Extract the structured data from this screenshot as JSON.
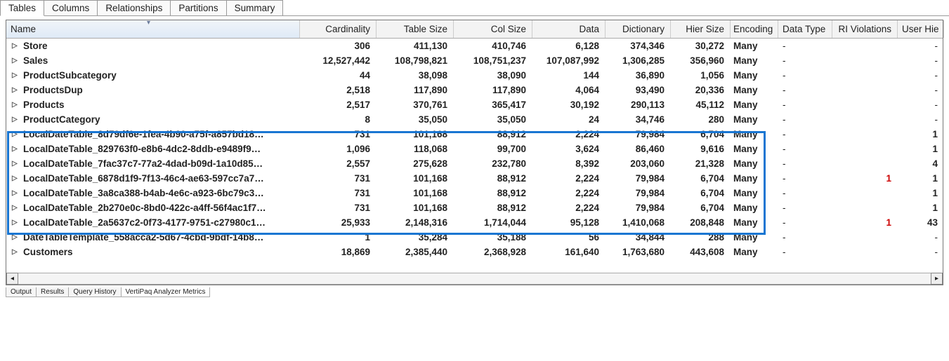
{
  "top_tabs": [
    "Tables",
    "Columns",
    "Relationships",
    "Partitions",
    "Summary"
  ],
  "active_top_tab": 0,
  "headers": {
    "name": "Name",
    "cardinality": "Cardinality",
    "table_size": "Table Size",
    "col_size": "Col Size",
    "data": "Data",
    "dictionary": "Dictionary",
    "hier_size": "Hier Size",
    "encoding": "Encoding",
    "data_type": "Data Type",
    "ri_violations": "RI Violations",
    "user_hier": "User Hie"
  },
  "rows": [
    {
      "name": "Store",
      "card": "306",
      "tsize": "411,130",
      "csize": "410,746",
      "data": "6,128",
      "dict": "374,346",
      "hier": "30,272",
      "enc": "Many",
      "dtype": "-",
      "ri": "",
      "uhier": "-",
      "hl": false
    },
    {
      "name": "Sales",
      "card": "12,527,442",
      "tsize": "108,798,821",
      "csize": "108,751,237",
      "data": "107,087,992",
      "dict": "1,306,285",
      "hier": "356,960",
      "enc": "Many",
      "dtype": "-",
      "ri": "",
      "uhier": "-",
      "hl": false
    },
    {
      "name": "ProductSubcategory",
      "card": "44",
      "tsize": "38,098",
      "csize": "38,090",
      "data": "144",
      "dict": "36,890",
      "hier": "1,056",
      "enc": "Many",
      "dtype": "-",
      "ri": "",
      "uhier": "-",
      "hl": false
    },
    {
      "name": "ProductsDup",
      "card": "2,518",
      "tsize": "117,890",
      "csize": "117,890",
      "data": "4,064",
      "dict": "93,490",
      "hier": "20,336",
      "enc": "Many",
      "dtype": "-",
      "ri": "",
      "uhier": "-",
      "hl": false
    },
    {
      "name": "Products",
      "card": "2,517",
      "tsize": "370,761",
      "csize": "365,417",
      "data": "30,192",
      "dict": "290,113",
      "hier": "45,112",
      "enc": "Many",
      "dtype": "-",
      "ri": "",
      "uhier": "-",
      "hl": false
    },
    {
      "name": "ProductCategory",
      "card": "8",
      "tsize": "35,050",
      "csize": "35,050",
      "data": "24",
      "dict": "34,746",
      "hier": "280",
      "enc": "Many",
      "dtype": "-",
      "ri": "",
      "uhier": "-",
      "hl": false
    },
    {
      "name": "LocalDateTable_8d79df6e-1fea-4b90-a75f-a857bd18…",
      "card": "731",
      "tsize": "101,168",
      "csize": "88,912",
      "data": "2,224",
      "dict": "79,984",
      "hier": "6,704",
      "enc": "Many",
      "dtype": "-",
      "ri": "",
      "uhier": "1",
      "hl": true
    },
    {
      "name": "LocalDateTable_829763f0-e8b6-4dc2-8ddb-e9489f9…",
      "card": "1,096",
      "tsize": "118,068",
      "csize": "99,700",
      "data": "3,624",
      "dict": "86,460",
      "hier": "9,616",
      "enc": "Many",
      "dtype": "-",
      "ri": "",
      "uhier": "1",
      "hl": true
    },
    {
      "name": "LocalDateTable_7fac37c7-77a2-4dad-b09d-1a10d85…",
      "card": "2,557",
      "tsize": "275,628",
      "csize": "232,780",
      "data": "8,392",
      "dict": "203,060",
      "hier": "21,328",
      "enc": "Many",
      "dtype": "-",
      "ri": "",
      "uhier": "4",
      "hl": true
    },
    {
      "name": "LocalDateTable_6878d1f9-7f13-46c4-ae63-597cc7a7…",
      "card": "731",
      "tsize": "101,168",
      "csize": "88,912",
      "data": "2,224",
      "dict": "79,984",
      "hier": "6,704",
      "enc": "Many",
      "dtype": "-",
      "ri": "1",
      "uhier": "1",
      "hl": true
    },
    {
      "name": "LocalDateTable_3a8ca388-b4ab-4e6c-a923-6bc79c3…",
      "card": "731",
      "tsize": "101,168",
      "csize": "88,912",
      "data": "2,224",
      "dict": "79,984",
      "hier": "6,704",
      "enc": "Many",
      "dtype": "-",
      "ri": "",
      "uhier": "1",
      "hl": true
    },
    {
      "name": "LocalDateTable_2b270e0c-8bd0-422c-a4ff-56f4ac1f7…",
      "card": "731",
      "tsize": "101,168",
      "csize": "88,912",
      "data": "2,224",
      "dict": "79,984",
      "hier": "6,704",
      "enc": "Many",
      "dtype": "-",
      "ri": "",
      "uhier": "1",
      "hl": true
    },
    {
      "name": "LocalDateTable_2a5637c2-0f73-4177-9751-c27980c1…",
      "card": "25,933",
      "tsize": "2,148,316",
      "csize": "1,714,044",
      "data": "95,128",
      "dict": "1,410,068",
      "hier": "208,848",
      "enc": "Many",
      "dtype": "-",
      "ri": "1",
      "uhier": "43",
      "hl": false
    },
    {
      "name": "DateTableTemplate_558acca2-5d67-4cbd-9bdf-14b8…",
      "card": "1",
      "tsize": "35,284",
      "csize": "35,188",
      "data": "56",
      "dict": "34,844",
      "hier": "288",
      "enc": "Many",
      "dtype": "-",
      "ri": "",
      "uhier": "-",
      "hl": false
    },
    {
      "name": "Customers",
      "card": "18,869",
      "tsize": "2,385,440",
      "csize": "2,368,928",
      "data": "161,640",
      "dict": "1,763,680",
      "hier": "443,608",
      "enc": "Many",
      "dtype": "-",
      "ri": "",
      "uhier": "-",
      "hl": false
    }
  ],
  "bottom_tabs": [
    "Output",
    "Results",
    "Query History",
    "VertiPaq Analyzer Metrics"
  ],
  "active_bottom_tab": 3
}
